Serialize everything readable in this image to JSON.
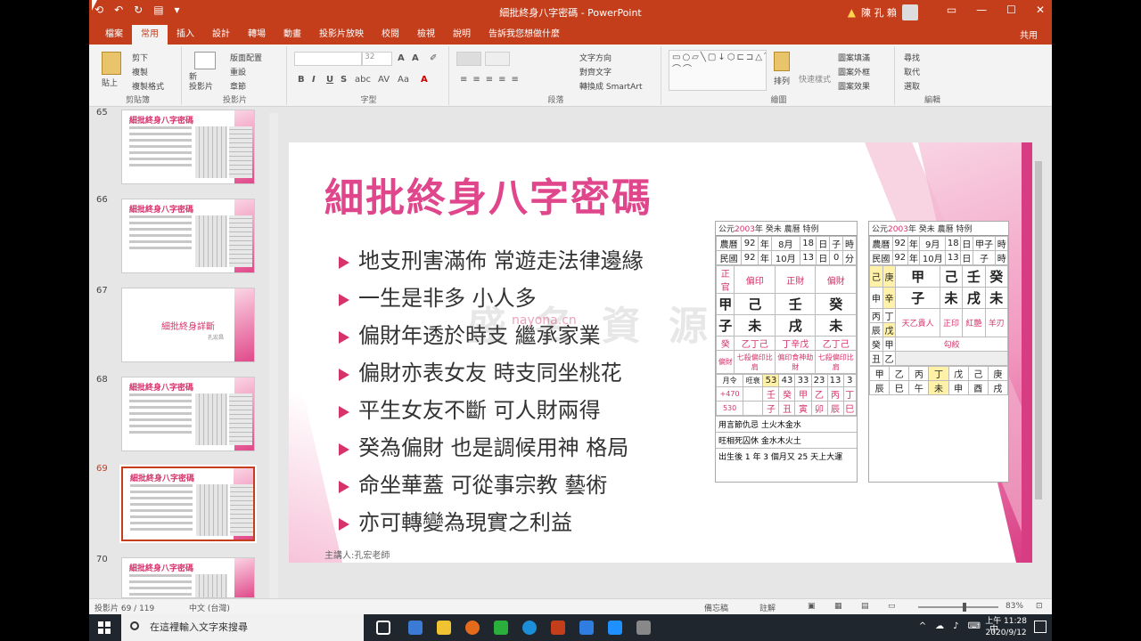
{
  "window": {
    "title": "細批終身八字密碼 - PowerPoint",
    "user": "陳 孔 賴",
    "controls": [
      "▭",
      "—",
      "☐",
      "✕"
    ]
  },
  "qat": [
    "⟲",
    "↶",
    "↻",
    "▤",
    "▾"
  ],
  "tabs": [
    "檔案",
    "常用",
    "插入",
    "設計",
    "轉場",
    "動畫",
    "投影片放映",
    "校閱",
    "檢視",
    "說明",
    "告訴我您想做什麼"
  ],
  "share_label": "共用",
  "ribbon": {
    "clipboard": {
      "label": "剪貼簿",
      "paste": "貼上",
      "cut": "剪下",
      "copy": "複製",
      "format": "複製格式"
    },
    "slides": {
      "label": "投影片",
      "new": "新\n投影片",
      "layout": "版面配置",
      "reset": "重設",
      "section": "章節"
    },
    "font": {
      "label": "字型",
      "size": "32",
      "bold": "B",
      "italic": "I",
      "underline": "U",
      "strike": "S",
      "shadow": "abc",
      "spacing": "AV",
      "case": "Aa"
    },
    "paragraph": {
      "label": "段落",
      "text_dir": "文字方向",
      "align_text": "對齊文字",
      "smartart": "轉換成 SmartArt"
    },
    "drawing": {
      "label": "繪圖",
      "arrange": "排列",
      "quick_styles": "快速樣式",
      "fill": "圖案填滿",
      "outline": "圖案外框",
      "effects": "圖案效果"
    },
    "editing": {
      "label": "編輯",
      "find": "尋找",
      "replace": "取代",
      "select": "選取"
    }
  },
  "thumbnails": [
    {
      "num": "65",
      "title": "細批終身八字密碼",
      "type": "content",
      "selected": false
    },
    {
      "num": "66",
      "title": "細批終身八字密碼",
      "type": "content",
      "selected": false
    },
    {
      "num": "67",
      "title": "細批終身詳斷",
      "subtitle": "孔宏昌",
      "type": "title",
      "selected": false
    },
    {
      "num": "68",
      "title": "細批終身八字密碼",
      "type": "content",
      "selected": false
    },
    {
      "num": "69",
      "title": "細批終身八字密碼",
      "type": "content",
      "selected": true
    },
    {
      "num": "70",
      "title": "細批終身八字密碼",
      "type": "content",
      "selected": false
    }
  ],
  "slide": {
    "title": "細批終身八字密碼",
    "bullets": [
      "地支刑害滿佈 常遊走法律邊緣",
      "一生是非多 小人多",
      "偏財年透於時支 繼承家業",
      "偏財亦表女友 時支同坐桃花",
      "平生女友不斷 可人財兩得",
      "癸為偏財 也是調候用神 格局",
      "命坐華蓋 可從事宗教 藝術",
      "亦可轉變為現實之利益"
    ],
    "presenter": "主講人:孔宏老師",
    "watermark": "盛 名 資 源 網",
    "watermark_url": "nayona.cn"
  },
  "chart1": {
    "header_pre": "公元",
    "header_year": "2003",
    "header_post": "年 癸未 農曆",
    "header_tag": "特例",
    "row_lunar": [
      "農曆",
      "92",
      "年",
      "8月",
      "18",
      "日",
      "子",
      "時"
    ],
    "row_roc": [
      "民國",
      "92",
      "年",
      "10月",
      "13",
      "日",
      "0",
      "分"
    ],
    "gods": [
      "正官",
      "偏印",
      "正財",
      "偏財"
    ],
    "stems": [
      "甲",
      "己",
      "壬",
      "癸"
    ],
    "branches": [
      "子",
      "未",
      "戌",
      "未"
    ],
    "hidden": [
      "癸",
      "乙丁己",
      "丁辛戊",
      "乙丁己"
    ],
    "hidden_gods": [
      "偏財",
      "七殺偏印比肩",
      "偏印食神劫財",
      "七殺偏印比肩"
    ],
    "luck_ages": [
      "月令",
      "旺衰",
      "53",
      "43",
      "33",
      "23",
      "13",
      "3"
    ],
    "luck_stems": [
      "+470",
      "",
      "壬",
      "癸",
      "甲",
      "乙",
      "丙",
      "丁"
    ],
    "luck_branches": [
      "530",
      "",
      "子",
      "丑",
      "寅",
      "卯",
      "辰",
      "巳"
    ],
    "bottom1": "用言節仇忌 土火木金水",
    "bottom2": "旺相死囚休 金水木火土",
    "footer": "出生後 1 年 3 個月又 25 天上大運"
  },
  "chart2": {
    "header_pre": "公元",
    "header_year": "2003",
    "header_post": "年 癸未 農曆",
    "header_tag": "特例",
    "row_lunar": [
      "農曆",
      "92",
      "年",
      "9月",
      "18",
      "日",
      "甲子",
      "時"
    ],
    "row_roc": [
      "民國",
      "92",
      "年",
      "10月",
      "13",
      "日",
      "子",
      "時"
    ],
    "pillars": [
      "甲",
      "己",
      "壬",
      "癸"
    ],
    "branches": [
      "子",
      "未",
      "戌",
      "未"
    ],
    "left_col": [
      "己",
      "申",
      "丙",
      "辰",
      "癸",
      "丑"
    ],
    "mid_col": [
      "庚",
      "辛",
      "丁",
      "戊",
      "甲",
      "乙"
    ],
    "notes": [
      "天乙貴人",
      "正印",
      "紅艷",
      "羊刃",
      "勾絞"
    ],
    "bottom_row": [
      "甲",
      "辰",
      "乙",
      "巳",
      "丙",
      "午",
      "丁",
      "未",
      "戊",
      "申",
      "己",
      "酉",
      "庚",
      "戌"
    ]
  },
  "status": {
    "slide_count": "投影片 69 / 119",
    "lang": "中文 (台灣)",
    "notes": "備忘稿",
    "comments": "註解",
    "zoom": "83%"
  },
  "taskbar": {
    "search_placeholder": "在這裡輸入文字來搜尋",
    "ime": "中",
    "time": "上午 11:28",
    "date": "2020/9/12"
  }
}
